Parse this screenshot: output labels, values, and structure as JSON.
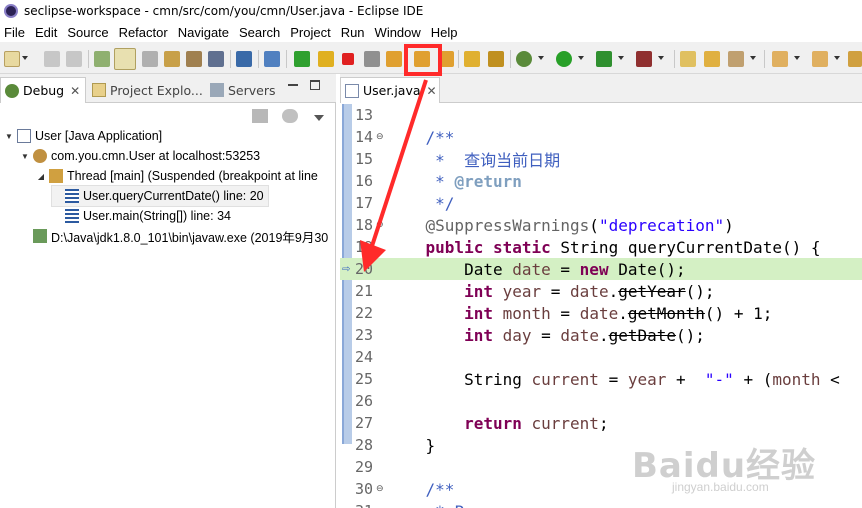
{
  "window": {
    "title": "seclipse-workspace - cmn/src/com/you/cmn/User.java - Eclipse IDE"
  },
  "menu": [
    "File",
    "Edit",
    "Source",
    "Refactor",
    "Navigate",
    "Search",
    "Project",
    "Run",
    "Window",
    "Help"
  ],
  "left_tabs": [
    {
      "label": "Debug",
      "close": "✕",
      "icon": "debug-bug-icon"
    },
    {
      "label": "Project Explo...",
      "close": "",
      "icon": "project-explorer-icon"
    },
    {
      "label": "Servers",
      "close": "",
      "icon": "servers-icon"
    }
  ],
  "debug_tree": [
    {
      "label": "User [Java Application]",
      "icon": "java-application-icon",
      "twisty": "▼"
    },
    {
      "label": "com.you.cmn.User at localhost:53253",
      "icon": "debug-target-icon",
      "twisty": "▼"
    },
    {
      "label": "Thread [main] (Suspended (breakpoint at line",
      "icon": "thread-suspended-icon",
      "twisty": "◢"
    },
    {
      "label": "User.queryCurrentDate() line: 20",
      "icon": "stack-frame-icon",
      "twisty": ""
    },
    {
      "label": "User.main(String[]) line: 34",
      "icon": "stack-frame-icon",
      "twisty": ""
    },
    {
      "label": "D:\\Java\\jdk1.8.0_101\\bin\\javaw.exe (2019年9月30",
      "icon": "process-icon",
      "twisty": ""
    }
  ],
  "editor_tab": {
    "label": "User.java",
    "close": "✕",
    "icon": "java-file-icon"
  },
  "code_lines": [
    {
      "n": "13",
      "fold": "",
      "html": ""
    },
    {
      "n": "14",
      "fold": "⊖",
      "html": "    <span class='cm'>/**</span>"
    },
    {
      "n": "15",
      "fold": "",
      "html": "    <span class='cm'> *  查询当前日期</span>"
    },
    {
      "n": "16",
      "fold": "",
      "html": "    <span class='cm'> * </span><span class='cmtag'>@return</span>"
    },
    {
      "n": "17",
      "fold": "",
      "html": "    <span class='cm'> */</span>"
    },
    {
      "n": "18",
      "fold": "⊖",
      "html": "    <span class='ann'>@SuppressWarnings</span>(<span class='str'>\"deprecation\"</span>)"
    },
    {
      "n": "19",
      "fold": "",
      "html": "    <span class='kw'>public</span> <span class='kw'>static</span> String queryCurrentDate() {"
    },
    {
      "n": "20",
      "fold": "",
      "html": "        Date <span class='fld'>date</span> = <span class='kw'>new</span> Date();"
    },
    {
      "n": "21",
      "fold": "",
      "html": "        <span class='kw'>int</span> <span class='fld'>year</span> = <span class='fld'>date</span>.<span class='dep'>getYear</span>();"
    },
    {
      "n": "22",
      "fold": "",
      "html": "        <span class='kw'>int</span> <span class='fld'>month</span> = <span class='fld'>date</span>.<span class='dep'>getMonth</span>() + 1;"
    },
    {
      "n": "23",
      "fold": "",
      "html": "        <span class='kw'>int</span> <span class='fld'>day</span> = <span class='fld'>date</span>.<span class='dep'>getDate</span>();"
    },
    {
      "n": "24",
      "fold": "",
      "html": ""
    },
    {
      "n": "25",
      "fold": "",
      "html": "        String <span class='fld'>current</span> = <span class='fld'>year</span> +  <span class='str'>\"-\"</span> + (<span class='fld'>month</span> &lt;"
    },
    {
      "n": "26",
      "fold": "",
      "html": ""
    },
    {
      "n": "27",
      "fold": "",
      "html": "        <span class='kw'>return</span> <span class='fld'>current</span>;"
    },
    {
      "n": "28",
      "fold": "",
      "html": "    }"
    },
    {
      "n": "29",
      "fold": "",
      "html": ""
    },
    {
      "n": "30",
      "fold": "⊖",
      "html": "    <span class='cm'>/**</span>"
    },
    {
      "n": "31",
      "fold": "",
      "html": "    <span class='cm'> * Program </span>"
    }
  ],
  "current_line_number": "20",
  "exec_marker": "⇨",
  "watermark": {
    "logo": "Baidu经验",
    "url": "jingyan.baidu.com"
  },
  "colors": {
    "annotation_red": "#ff2a2a",
    "current_line": "#d4f0c4"
  }
}
